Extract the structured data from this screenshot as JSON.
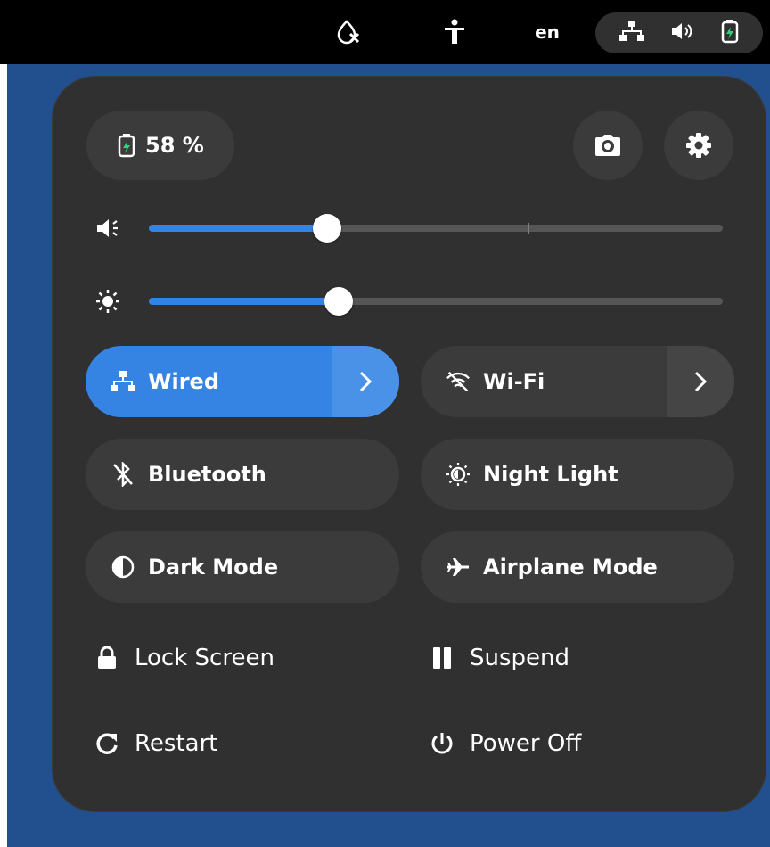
{
  "topbar": {
    "language": "en",
    "icons": [
      "night-light-disabled-icon",
      "accessibility-icon",
      "network-wired-icon",
      "volume-icon",
      "battery-charging-icon"
    ]
  },
  "panel": {
    "battery_label": "58 %",
    "screenshot_icon": "camera-icon",
    "settings_icon": "gear-icon",
    "volume": {
      "icon": "volume-low-icon",
      "level_percent": 31,
      "mark_percent": 66
    },
    "brightness": {
      "icon": "brightness-icon",
      "level_percent": 33
    },
    "toggles": [
      {
        "label": "Wired",
        "icon": "network-wired-icon",
        "active": true,
        "has_menu": true
      },
      {
        "label": "Wi-Fi",
        "icon": "wifi-disabled-icon",
        "active": false,
        "has_menu": true
      },
      {
        "label": "Bluetooth",
        "icon": "bluetooth-disabled-icon",
        "active": false,
        "has_menu": false
      },
      {
        "label": "Night Light",
        "icon": "night-light-icon",
        "active": false,
        "has_menu": false
      },
      {
        "label": "Dark Mode",
        "icon": "dark-mode-icon",
        "active": false,
        "has_menu": false
      },
      {
        "label": "Airplane Mode",
        "icon": "airplane-icon",
        "active": false,
        "has_menu": false
      }
    ],
    "actions": [
      {
        "label": "Lock Screen",
        "icon": "lock-icon"
      },
      {
        "label": "Suspend",
        "icon": "pause-icon"
      },
      {
        "label": "Restart",
        "icon": "restart-icon"
      },
      {
        "label": "Power Off",
        "icon": "power-icon"
      }
    ]
  },
  "colors": {
    "accent": "#3584e4",
    "panel_bg": "#303030",
    "button_bg": "#3b3b3b",
    "desktop_bg": "#22508f"
  }
}
